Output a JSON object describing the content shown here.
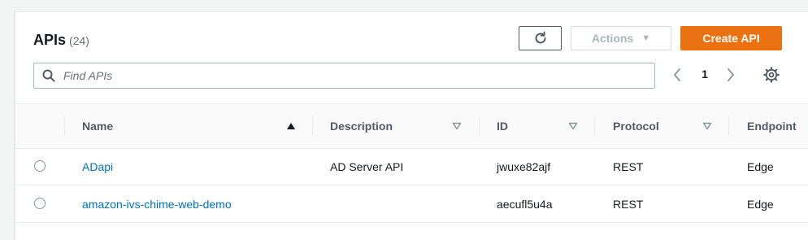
{
  "header": {
    "title": "APIs",
    "count": "(24)"
  },
  "toolbar": {
    "refresh_icon": "refresh-icon",
    "actions_label": "Actions",
    "actions_caret": "▼",
    "create_label": "Create API"
  },
  "search": {
    "placeholder": "Find APIs",
    "icon": "search-icon"
  },
  "pagination": {
    "current_page": "1",
    "prev_icon": "chevron-left-icon",
    "next_icon": "chevron-right-icon"
  },
  "settings_icon": "gear-icon",
  "colors": {
    "accent": "#ec7211",
    "link": "#0073bb",
    "text": "#16191f",
    "muted": "#687078"
  },
  "table": {
    "columns": [
      {
        "label": "Name",
        "sort": "ascending"
      },
      {
        "label": "Description",
        "sort": "none"
      },
      {
        "label": "ID",
        "sort": "none"
      },
      {
        "label": "Protocol",
        "sort": "none"
      },
      {
        "label": "Endpoint"
      }
    ],
    "rows": [
      {
        "name": "ADapi",
        "description": "AD Server API",
        "id": "jwuxe82ajf",
        "protocol": "REST",
        "endpoint": "Edge"
      },
      {
        "name": "amazon-ivs-chime-web-demo",
        "description": "",
        "id": "aecufl5u4a",
        "protocol": "REST",
        "endpoint": "Edge"
      }
    ]
  }
}
